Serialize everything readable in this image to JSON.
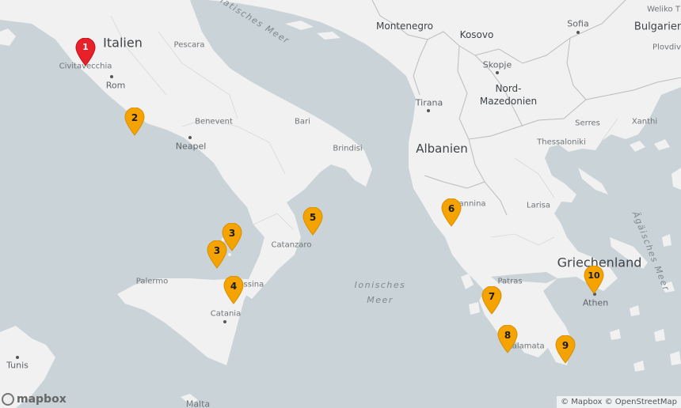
{
  "map": {
    "countries": [
      {
        "key": "italy",
        "name": "Italien"
      },
      {
        "key": "albania",
        "name": "Albanien"
      },
      {
        "key": "greece",
        "name": "Griechenland"
      },
      {
        "key": "montenegro",
        "name": "Montenegro"
      },
      {
        "key": "kosovo",
        "name": "Kosovo"
      },
      {
        "key": "northmacedonia",
        "name": "Nord-\nMazedonien"
      },
      {
        "key": "bulgaria",
        "name": "Bulgarien"
      }
    ],
    "capitals": [
      {
        "key": "rome",
        "name": "Rom"
      },
      {
        "key": "athens",
        "name": "Athen"
      },
      {
        "key": "tirana",
        "name": "Tirana"
      },
      {
        "key": "skopje",
        "name": "Skopje"
      },
      {
        "key": "sofia",
        "name": "Sofia"
      },
      {
        "key": "tunis",
        "name": "Tunis"
      }
    ],
    "cities": [
      {
        "key": "naples",
        "name": "Neapel"
      },
      {
        "key": "civitavecchia",
        "name": "Civitavecchia"
      },
      {
        "key": "pescara",
        "name": "Pescara"
      },
      {
        "key": "benevent",
        "name": "Benevent"
      },
      {
        "key": "bari",
        "name": "Bari"
      },
      {
        "key": "brindisi",
        "name": "Brindisi"
      },
      {
        "key": "catanzaro",
        "name": "Catanzaro"
      },
      {
        "key": "palermo",
        "name": "Palermo"
      },
      {
        "key": "messina",
        "name": "Messina"
      },
      {
        "key": "catania",
        "name": "Catania"
      },
      {
        "key": "malta",
        "name": "Malta"
      },
      {
        "key": "ioannina",
        "name": "Ioannina"
      },
      {
        "key": "patras",
        "name": "Patras"
      },
      {
        "key": "kalamata",
        "name": "Kalamata"
      },
      {
        "key": "larisa",
        "name": "Larisa"
      },
      {
        "key": "thessaloniki",
        "name": "Thessaloniki"
      },
      {
        "key": "serres",
        "name": "Serres"
      },
      {
        "key": "xanthi",
        "name": "Xanthi"
      },
      {
        "key": "weliko",
        "name": "Weliko T"
      },
      {
        "key": "plovdiv",
        "name": "Plovdiv"
      }
    ],
    "seas": [
      {
        "key": "adriatic",
        "name": "Adriatisches Meer"
      },
      {
        "key": "ionian",
        "name": "Ionisches\nMeer"
      },
      {
        "key": "aegean",
        "name": "Ägäisches Meer"
      }
    ],
    "markers": [
      {
        "label": "1",
        "color": "#e8202a",
        "kind": "start"
      },
      {
        "label": "2",
        "color": "#f5a300"
      },
      {
        "label": "3",
        "color": "#f5a300"
      },
      {
        "label": "3",
        "color": "#f5a300"
      },
      {
        "label": "4",
        "color": "#f5a300"
      },
      {
        "label": "5",
        "color": "#f5a300"
      },
      {
        "label": "6",
        "color": "#f5a300"
      },
      {
        "label": "7",
        "color": "#f5a300"
      },
      {
        "label": "8",
        "color": "#f5a300"
      },
      {
        "label": "9",
        "color": "#f5a300"
      },
      {
        "label": "10",
        "color": "#f5a300"
      }
    ],
    "logo": "mapbox",
    "attribution": "© Mapbox © OpenStreetMap"
  },
  "colors": {
    "water": "#c9d3d8",
    "land": "#f2f2f2",
    "border": "#b9bcbf",
    "marker_orange": "#f5a300",
    "marker_red": "#e8202a"
  }
}
